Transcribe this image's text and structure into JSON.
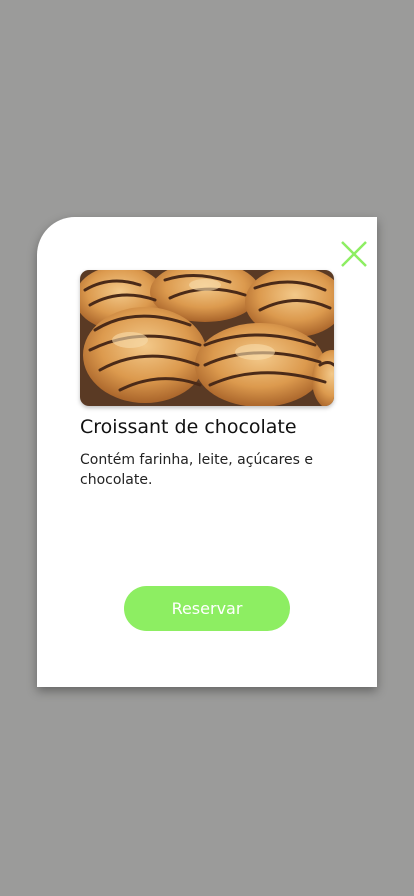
{
  "product": {
    "title": "Croissant de chocolate",
    "description": "Contém farinha, leite, açúcares e chocolate.",
    "image_icon": "croissant-photo"
  },
  "actions": {
    "reserve_label": "Reservar",
    "close_icon": "close-icon"
  },
  "colors": {
    "backdrop": "#9b9b9a",
    "card": "#ffffff",
    "accent": "#8dee62"
  }
}
